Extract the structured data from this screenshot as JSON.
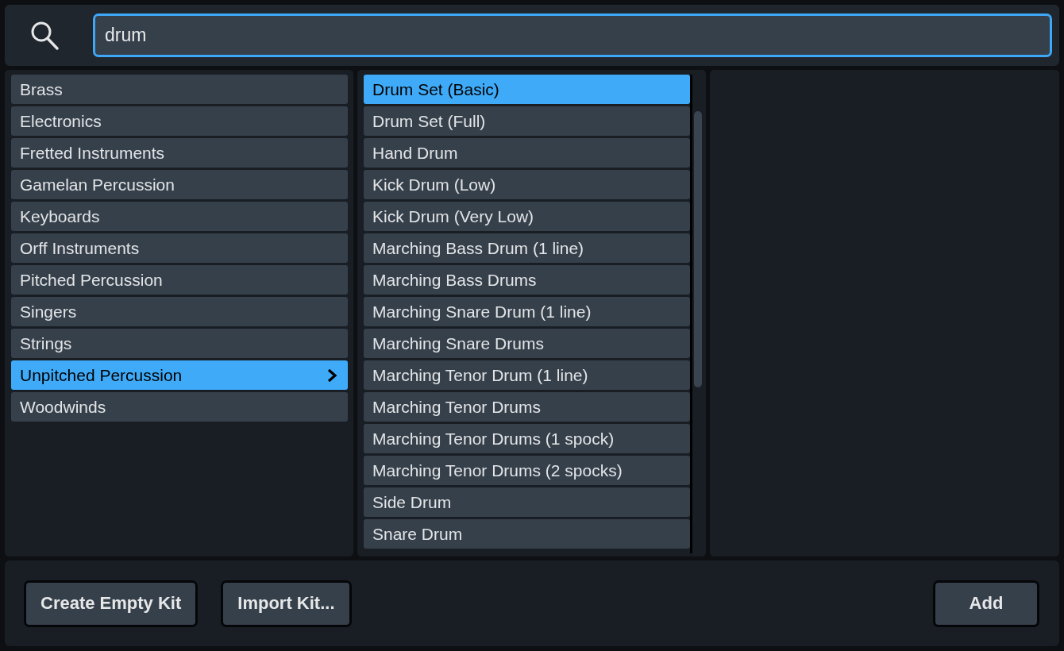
{
  "search": {
    "value": "drum",
    "focused": true
  },
  "categories": [
    {
      "label": "Brass",
      "selected": false
    },
    {
      "label": "Electronics",
      "selected": false
    },
    {
      "label": "Fretted Instruments",
      "selected": false
    },
    {
      "label": "Gamelan Percussion",
      "selected": false
    },
    {
      "label": "Keyboards",
      "selected": false
    },
    {
      "label": "Orff Instruments",
      "selected": false
    },
    {
      "label": "Pitched Percussion",
      "selected": false
    },
    {
      "label": "Singers",
      "selected": false
    },
    {
      "label": "Strings",
      "selected": false
    },
    {
      "label": "Unpitched Percussion",
      "selected": true
    },
    {
      "label": "Woodwinds",
      "selected": false
    }
  ],
  "instruments": [
    {
      "label": "Drum Set (Basic)",
      "selected": true
    },
    {
      "label": "Drum Set (Full)",
      "selected": false
    },
    {
      "label": "Hand Drum",
      "selected": false
    },
    {
      "label": "Kick Drum (Low)",
      "selected": false
    },
    {
      "label": "Kick Drum (Very Low)",
      "selected": false
    },
    {
      "label": "Marching Bass Drum (1 line)",
      "selected": false
    },
    {
      "label": "Marching Bass Drums",
      "selected": false
    },
    {
      "label": "Marching Snare Drum (1 line)",
      "selected": false
    },
    {
      "label": "Marching Snare Drums",
      "selected": false
    },
    {
      "label": "Marching Tenor Drum (1 line)",
      "selected": false
    },
    {
      "label": "Marching Tenor Drums",
      "selected": false
    },
    {
      "label": "Marching Tenor Drums (1 spock)",
      "selected": false
    },
    {
      "label": "Marching Tenor Drums (2 spocks)",
      "selected": false
    },
    {
      "label": "Side Drum",
      "selected": false
    },
    {
      "label": "Snare Drum",
      "selected": false
    }
  ],
  "footer": {
    "left_buttons": [
      "Create Empty Kit",
      "Import Kit..."
    ],
    "right_buttons": [
      "Add"
    ]
  }
}
